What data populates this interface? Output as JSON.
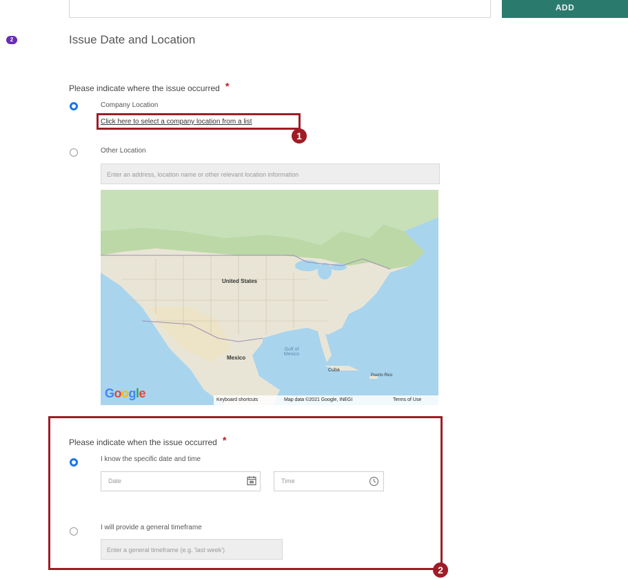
{
  "top": {
    "add_button_label": "ADD"
  },
  "section": {
    "step_number": "2",
    "title": "Issue Date and Location"
  },
  "where": {
    "question": "Please indicate where the issue occurred",
    "required_mark": "*",
    "option_company": "Company Location",
    "company_link": "Click here to select a company location from a list",
    "option_other": "Other Location",
    "other_placeholder": "Enter an address, location name or other relevant location information"
  },
  "map": {
    "country_label": "United States",
    "mexico_label": "Mexico",
    "gulf_label": "Gulf of Mexico",
    "cuba_label": "Cuba",
    "pr_label": "Puerto Rico",
    "google": [
      "G",
      "o",
      "o",
      "g",
      "l",
      "e"
    ],
    "google_colors": [
      "#4285F4",
      "#EA4335",
      "#FBBC05",
      "#4285F4",
      "#34A853",
      "#EA4335"
    ],
    "keyboard_shortcuts": "Keyboard shortcuts",
    "map_data": "Map data ©2021 Google, INEGI",
    "terms": "Terms of Use"
  },
  "when": {
    "question": "Please indicate when the issue occurred",
    "required_mark": "*",
    "option_specific": "I know the specific date and time",
    "date_placeholder": "Date",
    "time_placeholder": "Time",
    "option_general": "I will provide a general timeframe",
    "general_placeholder": "Enter a general timeframe (e.g. 'last week')"
  },
  "callouts": {
    "one": "1",
    "two": "2"
  },
  "colors": {
    "accent_green": "#2b7a6e",
    "callout_red": "#9e1c26",
    "radio_blue": "#1a73e8",
    "badge_purple": "#6a2bb8"
  }
}
